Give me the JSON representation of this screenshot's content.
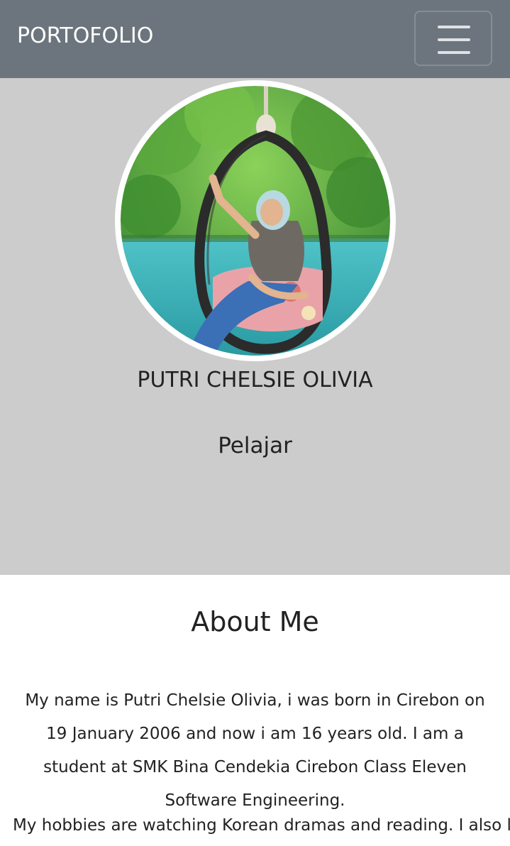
{
  "navbar": {
    "brand": "PORTOFOLIO",
    "menu_icon": "hamburger-menu-icon",
    "background_color": "#6c757d"
  },
  "hero": {
    "background_color": "#cccccc",
    "profile_photo": "profile-photo",
    "name": "PUTRI CHELSIE OLIVIA",
    "role": "Pelajar"
  },
  "about": {
    "title": "About Me",
    "paragraph_1": "My name is Putri Chelsie Olivia, i was born in Cirebon on 19 January 2006 and now i am 16 years old. I am a student at SMK Bina Cendekia Cirebon Class Eleven Software Engineering.",
    "paragraph_2": "My hobbies are watching Korean dramas and reading. I also like"
  }
}
